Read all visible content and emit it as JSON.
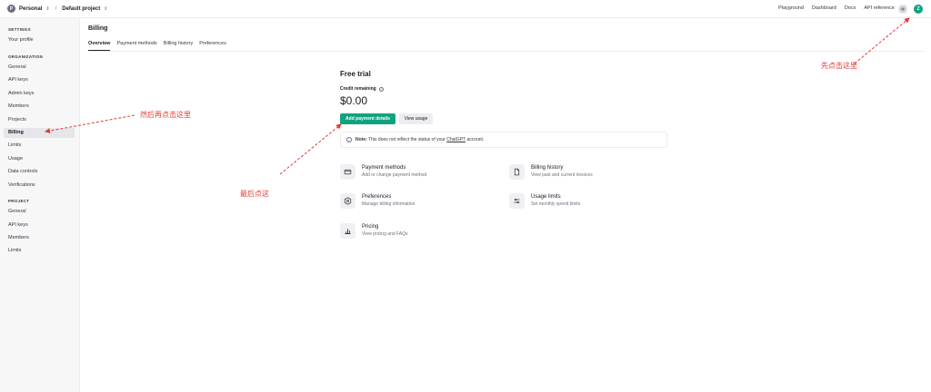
{
  "topbar": {
    "org_initial": "P",
    "org_name": "Personal",
    "separator": "/",
    "project_name": "Default project",
    "nav": [
      "Playground",
      "Dashboard",
      "Docs",
      "API reference"
    ],
    "user_initial": "Z"
  },
  "sidebar": {
    "settings_title": "SETTINGS",
    "settings_items": [
      "Your profile"
    ],
    "org_title": "ORGANIZATION",
    "org_items": [
      "General",
      "API keys",
      "Admin keys",
      "Members",
      "Projects",
      "Billing",
      "Limits",
      "Usage",
      "Data controls",
      "Verifications"
    ],
    "project_title": "PROJECT",
    "project_items": [
      "General",
      "API keys",
      "Members",
      "Limits"
    ],
    "active_item": "Billing"
  },
  "main": {
    "title": "Billing",
    "tabs": [
      "Overview",
      "Payment methods",
      "Billing history",
      "Preferences"
    ],
    "active_tab": "Overview",
    "trial_title": "Free trial",
    "credit_label": "Credit remaining",
    "credit_value": "$0.00",
    "add_payment_label": "Add payment details",
    "view_usage_label": "View usage",
    "note_prefix": "Note:",
    "note_text": " This does not reflect the status of your ",
    "note_link": "ChatGPT",
    "note_suffix": " account.",
    "cards": [
      {
        "title": "Payment methods",
        "desc": "Add or change payment method",
        "icon": "credit-card-icon"
      },
      {
        "title": "Billing history",
        "desc": "View past and current invoices",
        "icon": "document-icon"
      },
      {
        "title": "Preferences",
        "desc": "Manage billing information",
        "icon": "settings-hex-icon"
      },
      {
        "title": "Usage limits",
        "desc": "Set monthly spend limits",
        "icon": "sliders-icon"
      },
      {
        "title": "Pricing",
        "desc": "View pricing and FAQs",
        "icon": "bar-chart-icon"
      }
    ]
  },
  "annotations": {
    "first": "先点击这里",
    "second": "然后再点击这里",
    "last": "最后点这",
    "color": "#e53935"
  },
  "colors": {
    "accent": "#10a37f",
    "sidebar_bg": "#f7f7f8"
  }
}
